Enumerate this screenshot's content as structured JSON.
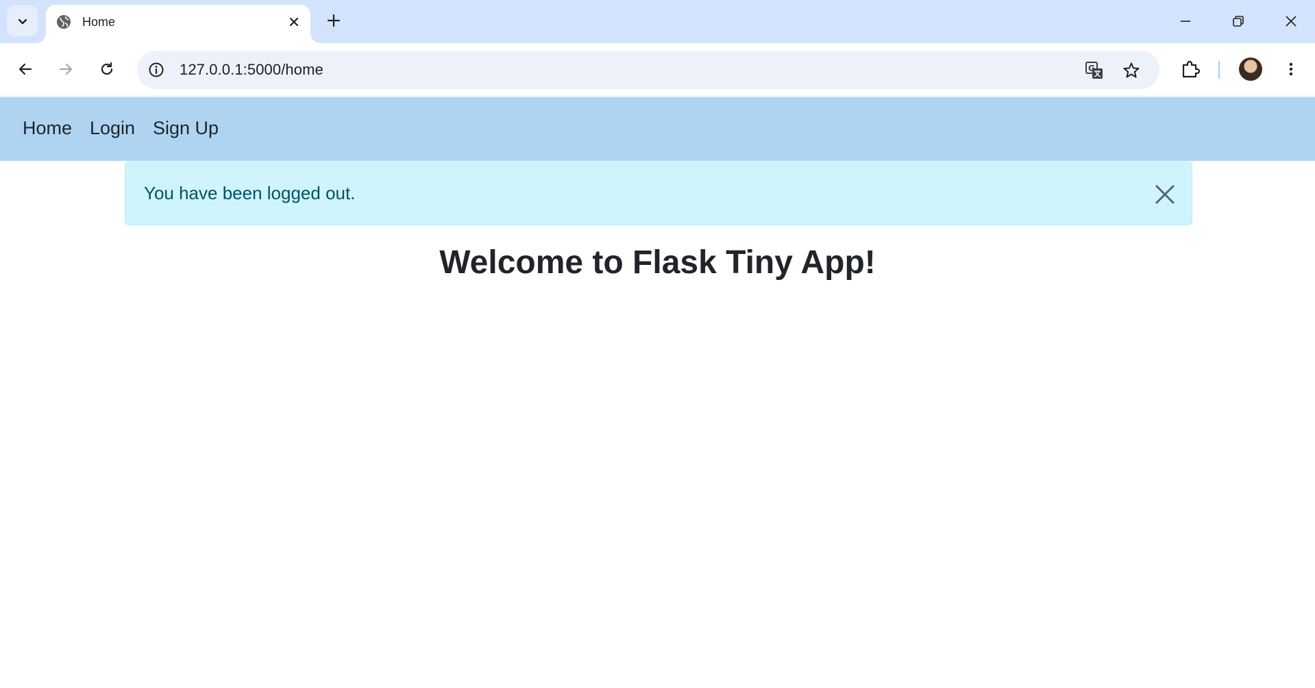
{
  "browser": {
    "tab": {
      "title": "Home"
    },
    "address_bar": {
      "url": "127.0.0.1:5000/home"
    },
    "icons": {
      "tab_search": "chevron-down-icon",
      "favicon": "globe-icon",
      "tab_close": "close-icon",
      "new_tab": "plus-icon",
      "minimize": "minimize-icon",
      "restore": "restore-icon",
      "close_window": "close-icon",
      "back": "arrow-left-icon",
      "forward": "arrow-right-icon",
      "reload": "reload-icon",
      "site_info": "info-icon",
      "translate": "translate-icon",
      "bookmark": "star-icon",
      "extensions": "puzzle-icon",
      "menu": "kebab-menu-icon"
    }
  },
  "page": {
    "navbar": {
      "links": [
        "Home",
        "Login",
        "Sign Up"
      ],
      "background": "#aed4f1"
    },
    "alert": {
      "message": "You have been logged out.",
      "background": "#cff4fc",
      "text_color": "#055160"
    },
    "heading": "Welcome to Flask Tiny App!"
  }
}
